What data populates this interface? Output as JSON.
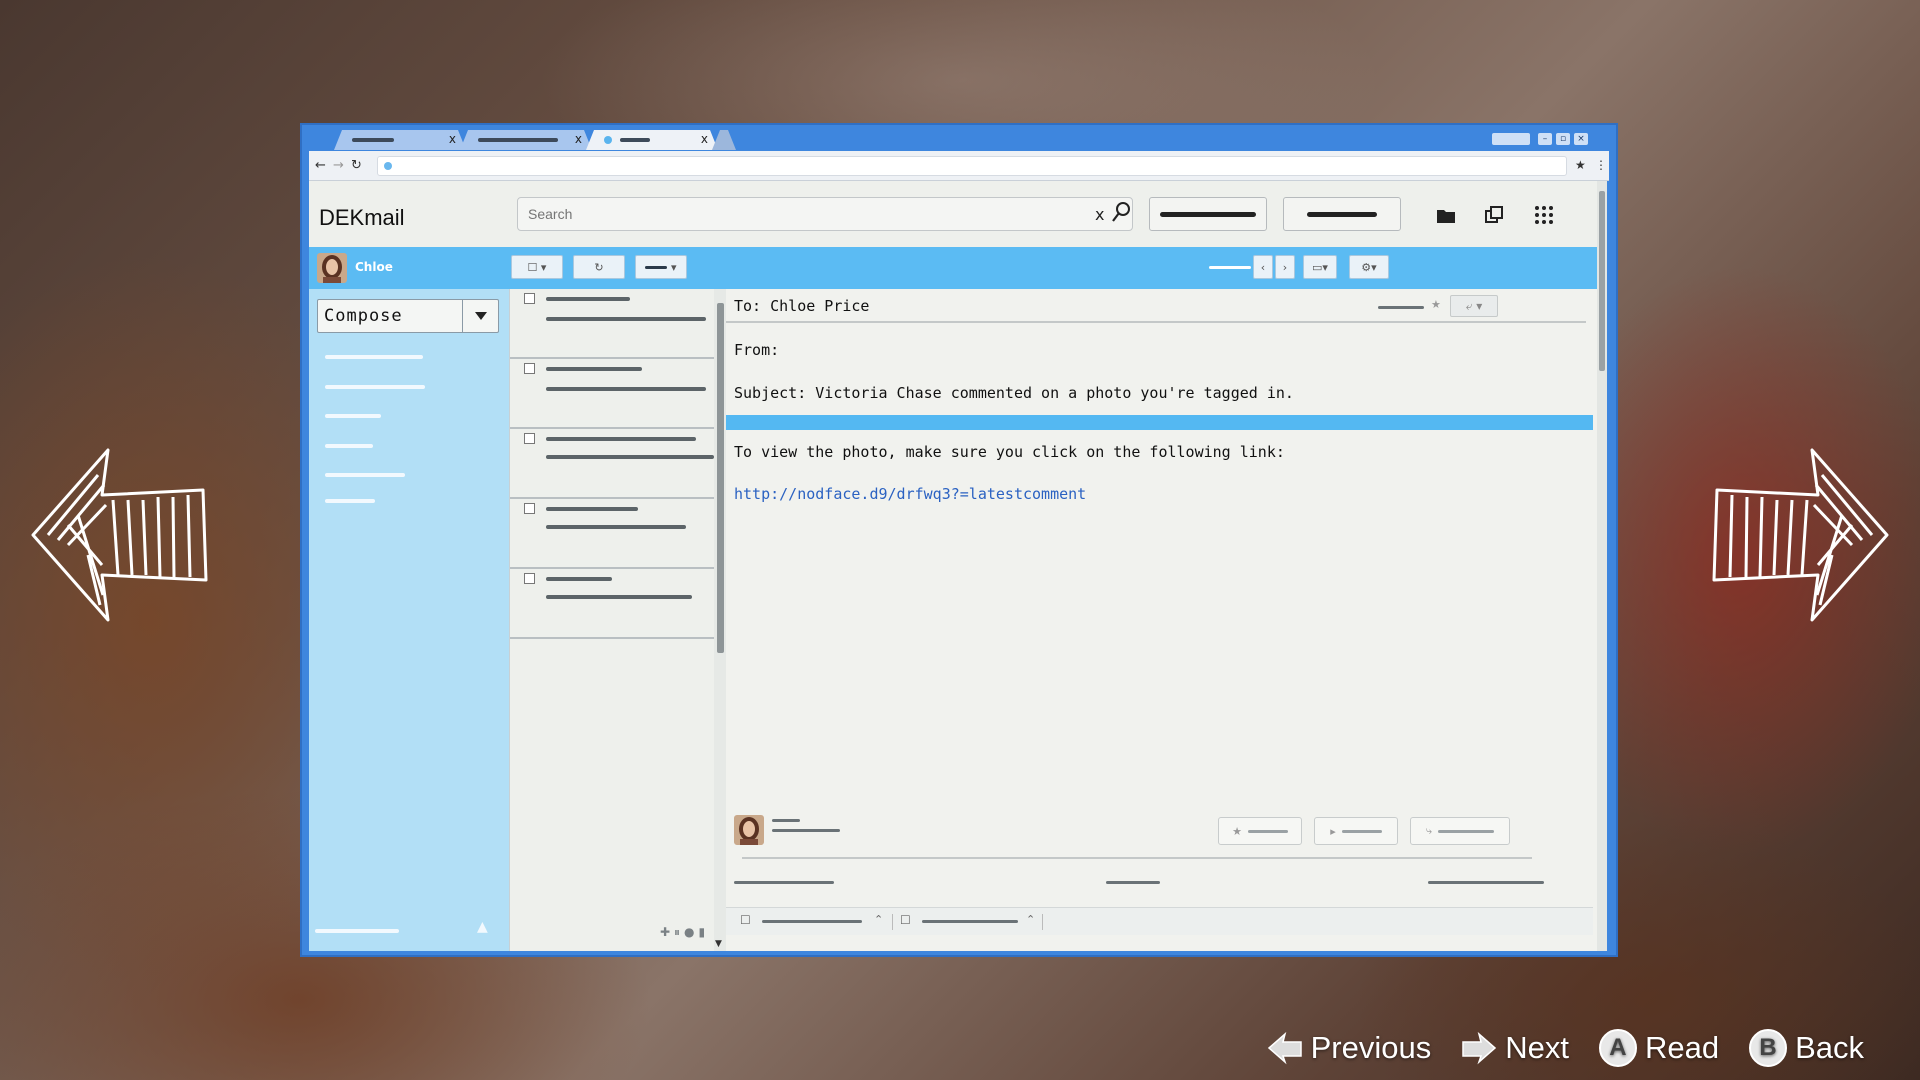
{
  "browser": {
    "tabs": [
      {
        "active": false
      },
      {
        "active": false
      },
      {
        "active": true
      }
    ],
    "tab_close_glyph": "x"
  },
  "app": {
    "name": "DEKmail",
    "search": {
      "placeholder": "Search",
      "clear_glyph": "x"
    },
    "user": {
      "name": "Chloe"
    },
    "compose": {
      "label": "Compose"
    }
  },
  "email": {
    "to_label": "To: Chloe Price",
    "from_label": "From:",
    "subject_label": "Subject: Victoria Chase commented on a photo you're tagged in.",
    "body": "To view the photo, make sure you click on the following link:",
    "link": "http://nodface.d9/drfwq3?=latestcomment"
  },
  "footer": {
    "previous": "Previous",
    "next": "Next",
    "read": "Read",
    "read_key": "A",
    "back": "Back",
    "back_key": "B"
  },
  "colors": {
    "window_frame": "#3e86de",
    "toolbar": "#5bbbf3",
    "sidebar": "#b2dff6",
    "link": "#2b62c2"
  }
}
